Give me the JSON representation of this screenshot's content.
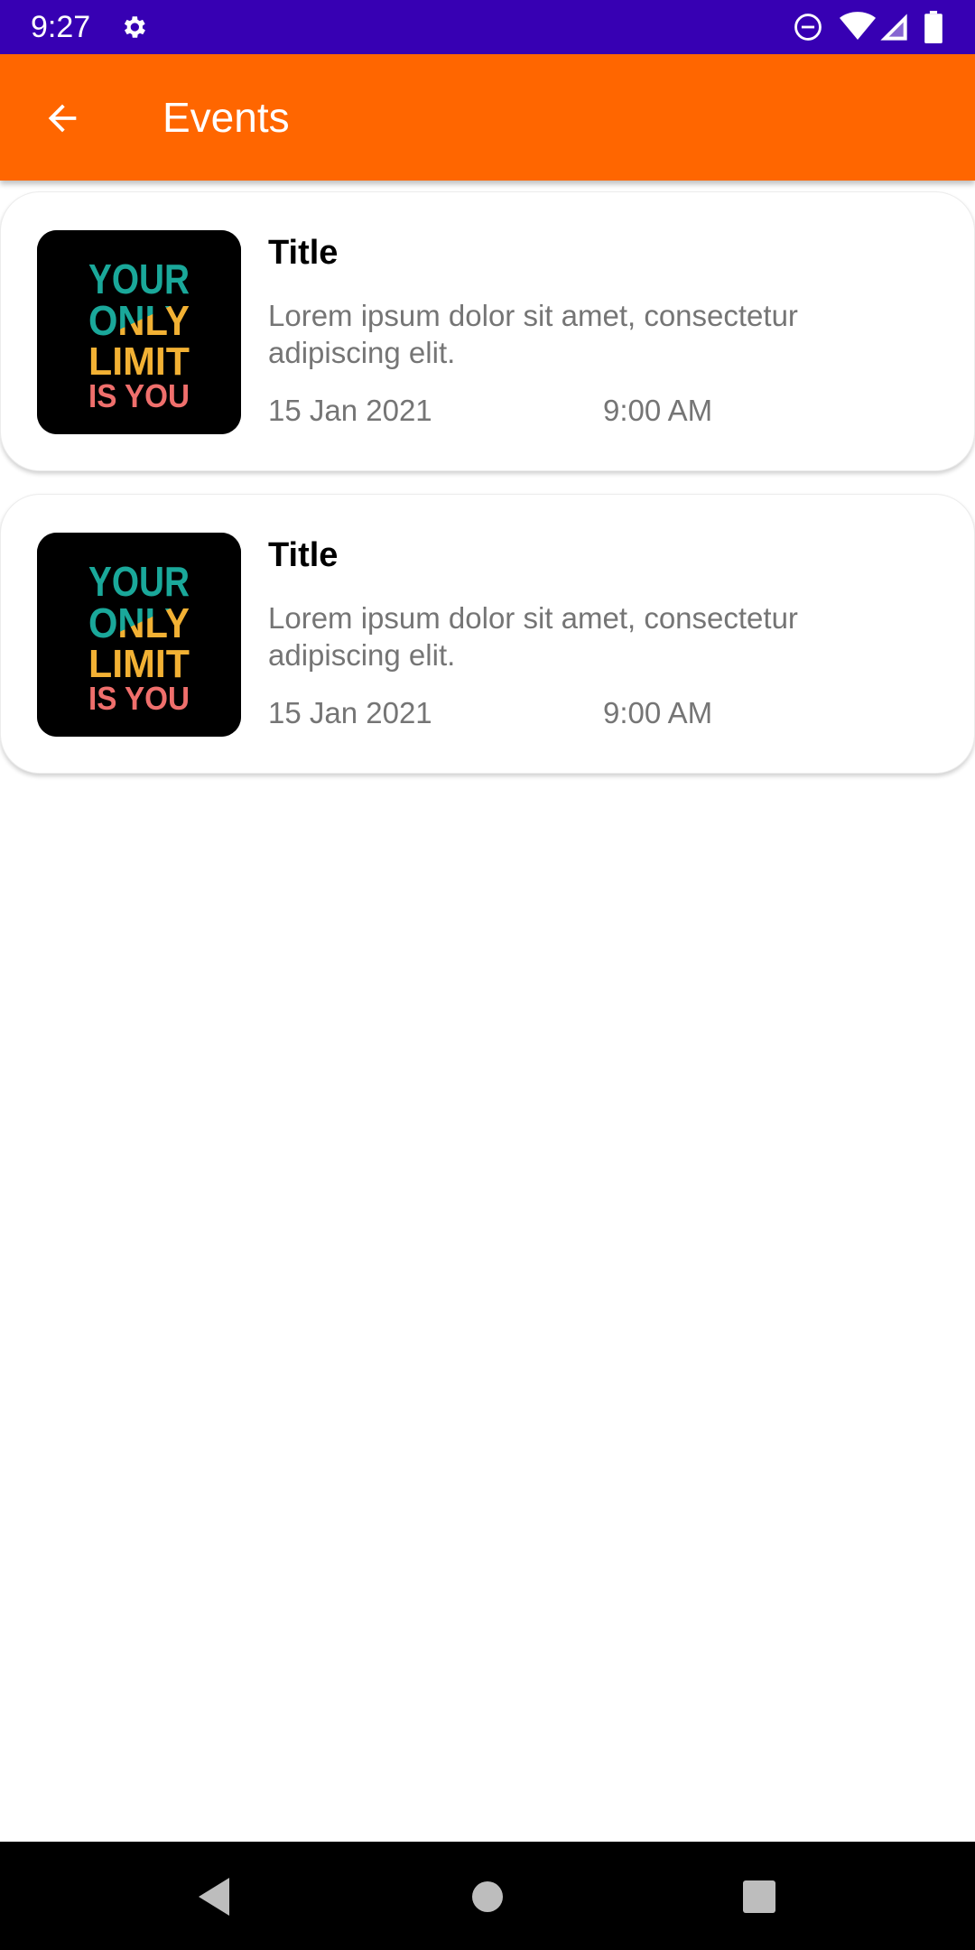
{
  "status_bar": {
    "time": "9:27",
    "icons": [
      "settings-icon",
      "do-not-disturb-icon",
      "wifi-icon",
      "signal-icon",
      "battery-icon"
    ],
    "background": "#3700b3"
  },
  "app_bar": {
    "title": "Events",
    "back_icon": "arrow-back-icon",
    "background": "#ff6600"
  },
  "events": [
    {
      "image_lines": [
        "YOUR",
        "ONLY",
        "LIMIT",
        "IS YOU"
      ],
      "title": "Title",
      "description": "Lorem ipsum dolor sit amet, consectetur adipiscing elit.",
      "date": "15 Jan 2021",
      "time": "9:00 AM"
    },
    {
      "image_lines": [
        "YOUR",
        "ONLY",
        "LIMIT",
        "IS YOU"
      ],
      "title": "Title",
      "description": "Lorem ipsum dolor sit amet, consectetur adipiscing elit.",
      "date": "15 Jan 2021",
      "time": "9:00 AM"
    }
  ],
  "nav_bar": {
    "icons": [
      "back-triangle-icon",
      "home-circle-icon",
      "recents-square-icon"
    ]
  }
}
